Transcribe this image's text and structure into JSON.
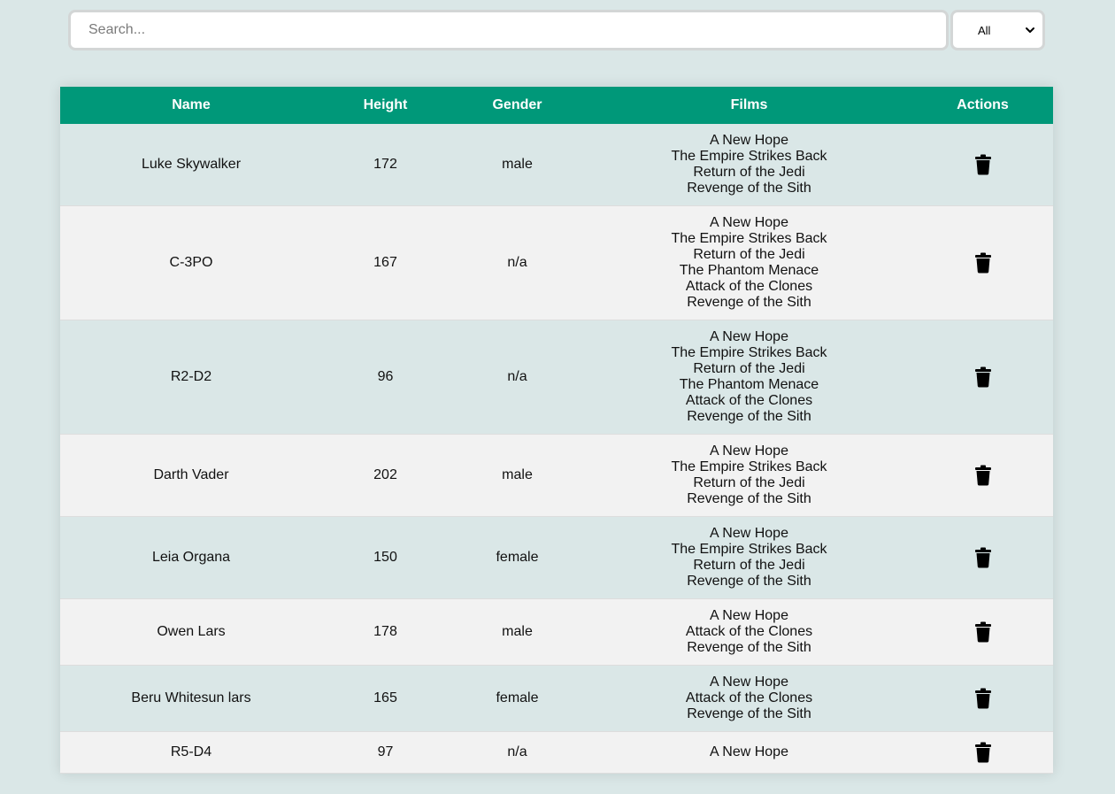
{
  "search": {
    "placeholder": "Search..."
  },
  "filter": {
    "selected": "All"
  },
  "table": {
    "headers": {
      "name": "Name",
      "height": "Height",
      "gender": "Gender",
      "films": "Films",
      "actions": "Actions"
    },
    "rows": [
      {
        "name": "Luke Skywalker",
        "height": "172",
        "gender": "male",
        "films": [
          "A New Hope",
          "The Empire Strikes Back",
          "Return of the Jedi",
          "Revenge of the Sith"
        ]
      },
      {
        "name": "C-3PO",
        "height": "167",
        "gender": "n/a",
        "films": [
          "A New Hope",
          "The Empire Strikes Back",
          "Return of the Jedi",
          "The Phantom Menace",
          "Attack of the Clones",
          "Revenge of the Sith"
        ]
      },
      {
        "name": "R2-D2",
        "height": "96",
        "gender": "n/a",
        "films": [
          "A New Hope",
          "The Empire Strikes Back",
          "Return of the Jedi",
          "The Phantom Menace",
          "Attack of the Clones",
          "Revenge of the Sith"
        ]
      },
      {
        "name": "Darth Vader",
        "height": "202",
        "gender": "male",
        "films": [
          "A New Hope",
          "The Empire Strikes Back",
          "Return of the Jedi",
          "Revenge of the Sith"
        ]
      },
      {
        "name": "Leia Organa",
        "height": "150",
        "gender": "female",
        "films": [
          "A New Hope",
          "The Empire Strikes Back",
          "Return of the Jedi",
          "Revenge of the Sith"
        ]
      },
      {
        "name": "Owen Lars",
        "height": "178",
        "gender": "male",
        "films": [
          "A New Hope",
          "Attack of the Clones",
          "Revenge of the Sith"
        ]
      },
      {
        "name": "Beru Whitesun lars",
        "height": "165",
        "gender": "female",
        "films": [
          "A New Hope",
          "Attack of the Clones",
          "Revenge of the Sith"
        ]
      },
      {
        "name": "R5-D4",
        "height": "97",
        "gender": "n/a",
        "films": [
          "A New Hope"
        ]
      }
    ]
  },
  "icons": {
    "delete": "trash-icon",
    "dropdown": "chevron-down-icon"
  },
  "colors": {
    "header": "#009879",
    "background": "#dae7e7",
    "row_alt": "#f2f2f2"
  }
}
